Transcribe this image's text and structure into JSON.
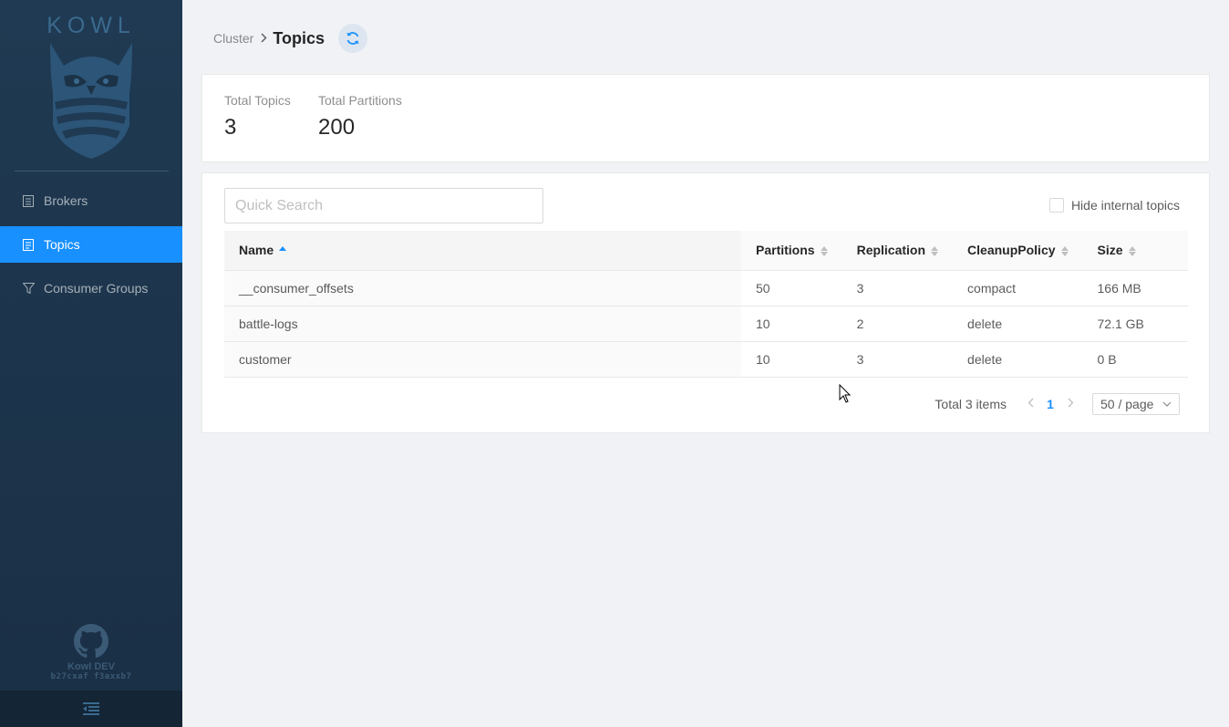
{
  "brand": {
    "logo_text": "KOWL"
  },
  "sidebar": {
    "items": [
      {
        "label": "Brokers",
        "icon": "brokers-icon",
        "active": false
      },
      {
        "label": "Topics",
        "icon": "topics-icon",
        "active": true
      },
      {
        "label": "Consumer Groups",
        "icon": "funnel-icon",
        "active": false
      }
    ],
    "footer": {
      "env": "Kowl DEV",
      "version": "b27cxaf f3axxb7"
    }
  },
  "breadcrumb": {
    "parent": "Cluster",
    "separator": ">",
    "title": "Topics"
  },
  "stats": [
    {
      "label": "Total Topics",
      "value": "3"
    },
    {
      "label": "Total Partitions",
      "value": "200"
    }
  ],
  "search": {
    "placeholder": "Quick Search",
    "value": ""
  },
  "filter": {
    "hide_internal_label": "Hide internal topics",
    "checked": false
  },
  "table": {
    "columns": [
      "Name",
      "Partitions",
      "Replication",
      "CleanupPolicy",
      "Size"
    ],
    "rows": [
      {
        "name": "__consumer_offsets",
        "partitions": "50",
        "replication": "3",
        "cleanup": "compact",
        "size": "166 MB"
      },
      {
        "name": "battle-logs",
        "partitions": "10",
        "replication": "2",
        "cleanup": "delete",
        "size": "72.1 GB"
      },
      {
        "name": "customer",
        "partitions": "10",
        "replication": "3",
        "cleanup": "delete",
        "size": "0 B"
      }
    ]
  },
  "pagination": {
    "total": "Total 3 items",
    "current": "1",
    "page_size": "50 / page"
  },
  "colors": {
    "sidebar": "#1f3a52",
    "accent": "#1890ff",
    "background": "#f0f2f5"
  }
}
